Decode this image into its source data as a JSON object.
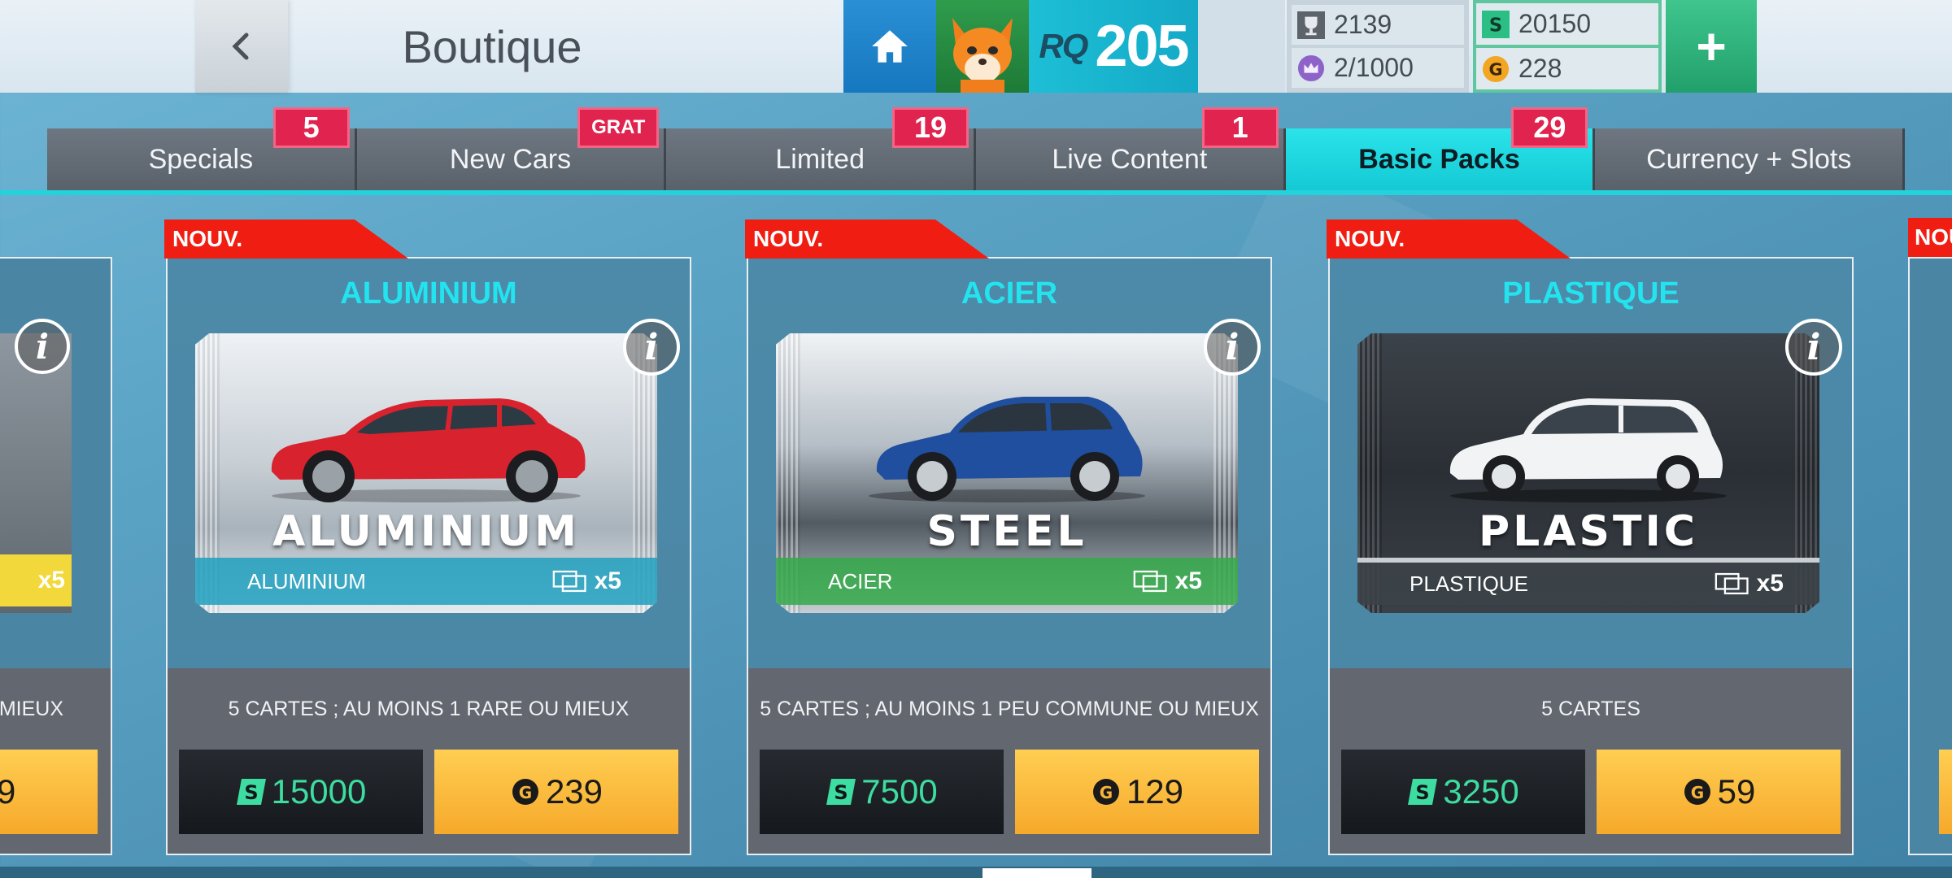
{
  "header": {
    "back_label": "back",
    "title": "Boutique",
    "rank_label": "RQ",
    "rank_value": "205",
    "trophies": "2139",
    "crowns": "2/1000",
    "cash": "20150",
    "gold": "228",
    "add_label": "+"
  },
  "tabs": [
    {
      "label": "Specials",
      "badge": "5"
    },
    {
      "label": "New Cars",
      "badge": "GRAT"
    },
    {
      "label": "Limited",
      "badge": "19"
    },
    {
      "label": "Live Content",
      "badge": "1"
    },
    {
      "label": "Basic Packs",
      "badge": "29",
      "active": true
    },
    {
      "label": "Currency + Slots",
      "badge": ""
    }
  ],
  "left_partial": {
    "count": "x5",
    "desc": "MIEUX",
    "price": "9"
  },
  "right_partial": {
    "nouv": "NOU"
  },
  "cards": [
    {
      "nouv": "NOUV.",
      "name": "ALUMINIUM",
      "pack_title": "ALUMINIUM",
      "strip_label": "ALUMINIUM",
      "count": "x5",
      "description": "5 CARTES ; AU MOINS 1 RARE OU MIEUX",
      "cash_price": "15000",
      "gold_price": "239"
    },
    {
      "nouv": "NOUV.",
      "name": "ACIER",
      "pack_title": "STEEL",
      "strip_label": "ACIER",
      "count": "x5",
      "description": "5 CARTES ; AU MOINS 1 PEU COMMUNE OU MIEUX",
      "cash_price": "7500",
      "gold_price": "129"
    },
    {
      "nouv": "NOUV.",
      "name": "PLASTIQUE",
      "pack_title": "PLASTIC",
      "strip_label": "PLASTIQUE",
      "count": "x5",
      "description": "5 CARTES",
      "cash_price": "3250",
      "gold_price": "59"
    }
  ],
  "colors": {
    "accent": "#22d3dc",
    "badge": "#e0244f",
    "nouv": "#f01e12",
    "cash": "#3ddca0",
    "gold_button": "#f6a92b"
  }
}
